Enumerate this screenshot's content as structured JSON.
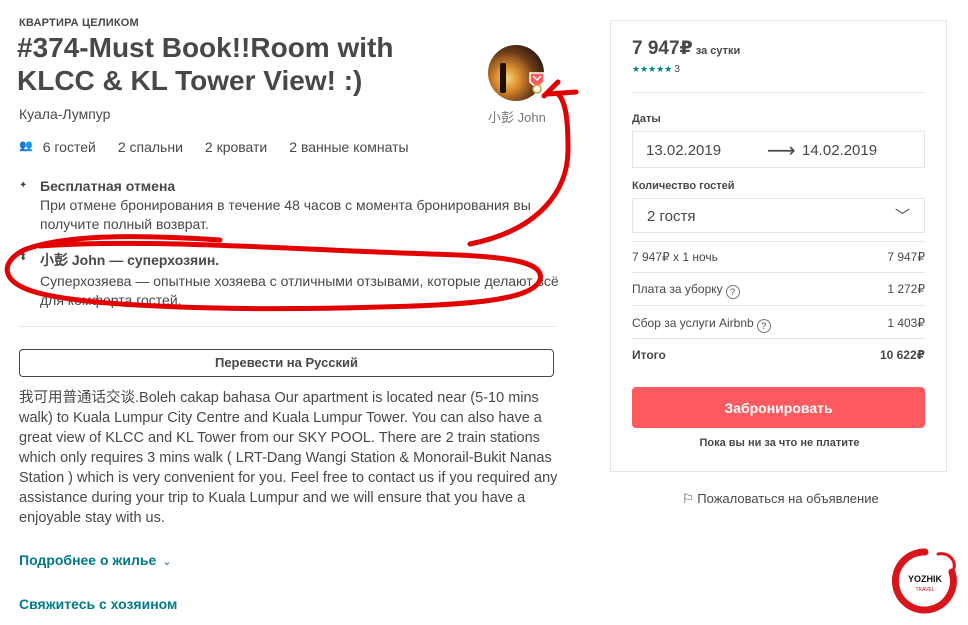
{
  "listing": {
    "room_type": "КВАРТИРА ЦЕЛИКОМ",
    "title": "#374-Must Book!!Room with KLCC & KL Tower View! :)",
    "city": "Куала-Лумпур",
    "host_name": "小彭 John"
  },
  "amenities": {
    "guests": "6 гостей",
    "bedrooms": "2 спальни",
    "beds": "2 кровати",
    "baths": "2 ванные комнаты"
  },
  "features": [
    {
      "title": "Бесплатная отмена",
      "text": "При отмене бронирования в течение 48 часов с момента бронирования вы получите полный возврат."
    },
    {
      "title": "小彭 John — суперхозяин.",
      "text": "Суперхозяева — опытные хозяева с отличными отзывами, которые делают всё для комфорта гостей."
    }
  ],
  "translate_label": "Перевести на Русский",
  "description": "我可用普通话交谈.Boleh cakap bahasa Our apartment is located near (5-10 mins walk) to Kuala Lumpur City Centre and Kuala Lumpur Tower. You can also have a great view of KLCC and KL Tower from our SKY POOL. There are 2 train stations which only requires 3 mins walk ( LRT-Dang Wangi Station & Monorail-Bukit Nanas Station ) which is very convenient for you. Feel free to contact us if you required any assistance during your trip to Kuala Lumpur and we will ensure that you have a enjoyable stay with us.",
  "links": {
    "more_about": "Подробнее о жилье",
    "contact_host": "Свяжитесь с хозяином"
  },
  "booking": {
    "price": "7 947₽",
    "per_night": "за сутки",
    "stars": "★★★★★",
    "review_count": "3",
    "dates_label": "Даты",
    "checkin": "13.02.2019",
    "checkout": "14.02.2019",
    "guests_label": "Количество гостей",
    "guests_value": "2 гостя",
    "rows": [
      {
        "label": "7 947₽ x 1 ночь",
        "value": "7 947₽"
      },
      {
        "label": "Плата за уборку",
        "value": "1 272₽"
      },
      {
        "label": "Сбор за услуги Airbnb",
        "value": "1 403₽"
      }
    ],
    "total_label": "Итого",
    "total_value": "10 622₽",
    "book_button": "Забронировать",
    "note": "Пока вы ни за что не платите"
  },
  "report_link": "Пожаловаться на объявление",
  "watermark": {
    "line1": "YOZHIK",
    "line2": "TRAVEL"
  },
  "colors": {
    "accent": "#ff5a5f",
    "link": "#007a87",
    "annotation": "#e30000"
  }
}
